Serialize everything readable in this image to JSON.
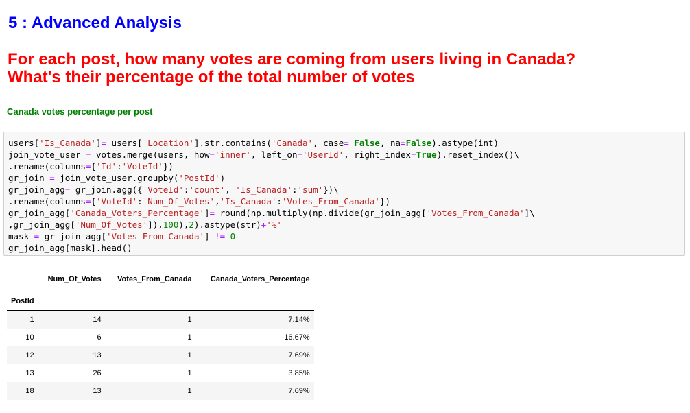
{
  "section_title": "5 : Advanced Analysis",
  "question": {
    "line1": "For each post, how many votes are coming from users living in Canada?",
    "line2": "What's their percentage of the total number of votes"
  },
  "subheading": "Canada votes percentage per post",
  "code_lines": [
    "users['Is_Canada']= users['Location'].str.contains('Canada', case= False, na=False).astype(int)",
    "join_vote_user = votes.merge(users, how='inner', left_on='UserId', right_index=True).reset_index()\\",
    ".rename(columns={'Id':'VoteId'})",
    "gr_join = join_vote_user.groupby('PostId')",
    "gr_join_agg= gr_join.agg({'VoteId':'count', 'Is_Canada':'sum'})\\",
    ".rename(columns={'VoteId':'Num_Of_Votes','Is_Canada':'Votes_From_Canada'})",
    "gr_join_agg['Canada_Voters_Percentage']= round(np.multiply(np.divide(gr_join_agg['Votes_From_Canada']\\",
    ",gr_join_agg['Num_Of_Votes']),100),2).astype(str)+'%'",
    "mask = gr_join_agg['Votes_From_Canada'] != 0",
    "gr_join_agg[mask].head()"
  ],
  "table": {
    "columns": [
      "Num_Of_Votes",
      "Votes_From_Canada",
      "Canada_Voters_Percentage"
    ],
    "index_name": "PostId",
    "rows": [
      {
        "index": "1",
        "values": [
          "14",
          "1",
          "7.14%"
        ]
      },
      {
        "index": "10",
        "values": [
          "6",
          "1",
          "16.67%"
        ]
      },
      {
        "index": "12",
        "values": [
          "13",
          "1",
          "7.69%"
        ]
      },
      {
        "index": "13",
        "values": [
          "26",
          "1",
          "3.85%"
        ]
      },
      {
        "index": "18",
        "values": [
          "13",
          "1",
          "7.69%"
        ]
      }
    ]
  },
  "colors": {
    "section_title": "#0000ff",
    "question": "#ff0000",
    "subheading": "#008000",
    "code_background": "#f7f7f7",
    "string_literal": "#ba2121",
    "keyword": "#008000",
    "operator": "#aa22ff"
  }
}
